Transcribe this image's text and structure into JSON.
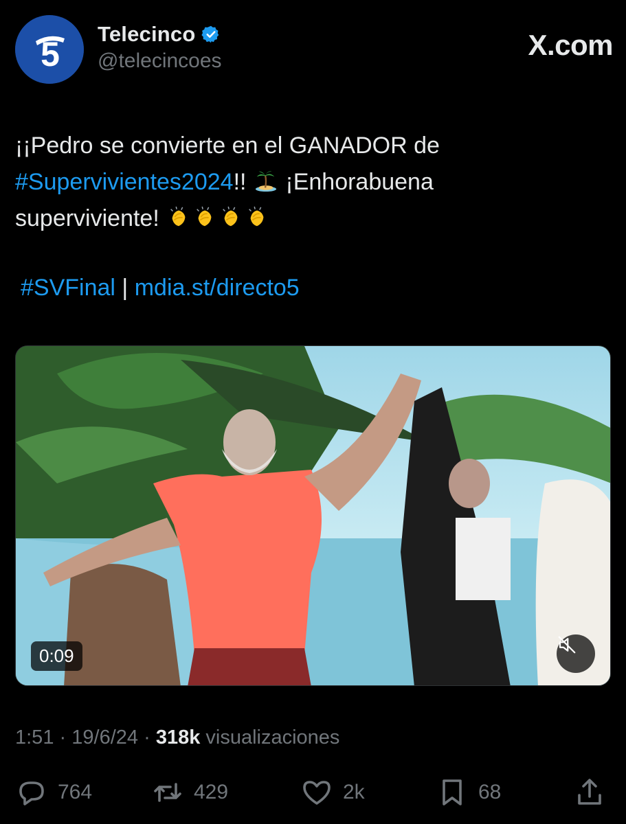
{
  "header": {
    "display_name": "Telecinco",
    "handle": "@telecincoes",
    "brand": "X.com",
    "avatar_glyph": "5",
    "verified_icon": "verified-badge-icon"
  },
  "tweet": {
    "line1": "¡¡Pedro se convierte en el GANADOR de",
    "hashtag_main": "#Supervivientes2024",
    "after_hashtag": "!!",
    "congrats": "¡Enhorabuena",
    "line3": "superviviente!",
    "emojis": [
      "island-emoji",
      "clapping-hands-emoji",
      "clapping-hands-emoji",
      "clapping-hands-emoji",
      "clapping-hands-emoji"
    ],
    "hashtag_final": "#SVFinal",
    "separator": "|",
    "link": "mdia.st/directo5"
  },
  "media": {
    "duration": "0:09",
    "mute_icon": "muted-speaker-icon"
  },
  "meta": {
    "time": "1:51",
    "dot1": "·",
    "date": "19/6/24",
    "dot2": "·",
    "views": "318k",
    "views_label": "visualizaciones"
  },
  "actions": {
    "replies": "764",
    "reposts": "429",
    "likes": "2k",
    "bookmarks": "68"
  },
  "colors": {
    "background": "#000000",
    "text": "#e7e9ea",
    "muted": "#71767b",
    "link": "#1d9bf0",
    "verified": "#1d9bf0"
  }
}
